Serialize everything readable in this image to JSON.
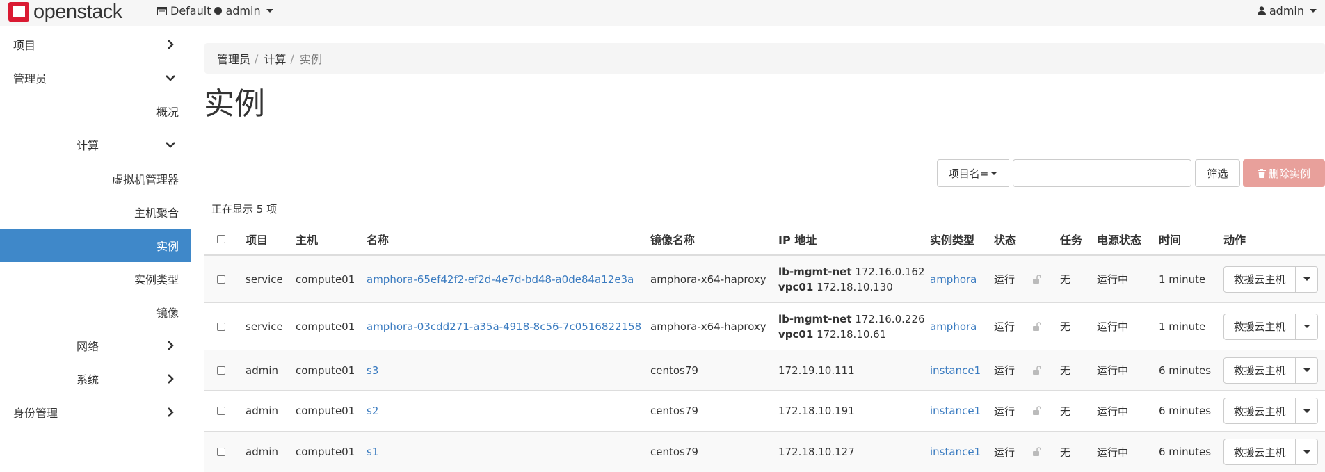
{
  "header": {
    "logo_text": "openstack",
    "domain": "Default",
    "project": "admin",
    "user": "admin"
  },
  "sidebar": {
    "items": [
      {
        "label": "项目",
        "chevron": "right"
      },
      {
        "label": "管理员",
        "chevron": "down"
      },
      {
        "label": "概况"
      },
      {
        "label": "计算",
        "chevron": "down"
      },
      {
        "label": "虚拟机管理器"
      },
      {
        "label": "主机聚合"
      },
      {
        "label": "实例",
        "active": true
      },
      {
        "label": "实例类型"
      },
      {
        "label": "镜像"
      },
      {
        "label": "网络",
        "chevron": "right"
      },
      {
        "label": "系统",
        "chevron": "right"
      },
      {
        "label": "身份管理",
        "chevron": "right"
      }
    ]
  },
  "breadcrumb": [
    "管理员",
    "计算",
    "实例"
  ],
  "page_title": "实例",
  "filter": {
    "field_label": "项目名=",
    "input_value": "",
    "filter_button": "筛选",
    "delete_button": "删除实例"
  },
  "count_text": "正在显示 5 项",
  "table": {
    "headers": [
      "项目",
      "主机",
      "名称",
      "镜像名称",
      "IP 地址",
      "实例类型",
      "状态",
      "任务",
      "电源状态",
      "时间",
      "动作"
    ],
    "rows": [
      {
        "project": "service",
        "host": "compute01",
        "name": "amphora-65ef42f2-ef2d-4e7d-bd48-a0de84a12e3a",
        "image": "amphora-x64-haproxy",
        "ip": [
          {
            "net": "lb-mgmt-net",
            "addr": "172.16.0.162"
          },
          {
            "net": "vpc01",
            "addr": "172.18.10.130"
          }
        ],
        "flavor": "amphora",
        "status": "运行",
        "task": "无",
        "power": "运行中",
        "time": "1 minute",
        "action": "救援云主机"
      },
      {
        "project": "service",
        "host": "compute01",
        "name": "amphora-03cdd271-a35a-4918-8c56-7c0516822158",
        "image": "amphora-x64-haproxy",
        "ip": [
          {
            "net": "lb-mgmt-net",
            "addr": "172.16.0.226"
          },
          {
            "net": "vpc01",
            "addr": "172.18.10.61"
          }
        ],
        "flavor": "amphora",
        "status": "运行",
        "task": "无",
        "power": "运行中",
        "time": "1 minute",
        "action": "救援云主机"
      },
      {
        "project": "admin",
        "host": "compute01",
        "name": "s3",
        "image": "centos79",
        "ip_plain": "172.19.10.111",
        "flavor": "instance1",
        "status": "运行",
        "task": "无",
        "power": "运行中",
        "time": "6 minutes",
        "action": "救援云主机"
      },
      {
        "project": "admin",
        "host": "compute01",
        "name": "s2",
        "image": "centos79",
        "ip_plain": "172.18.10.191",
        "flavor": "instance1",
        "status": "运行",
        "task": "无",
        "power": "运行中",
        "time": "6 minutes",
        "action": "救援云主机"
      },
      {
        "project": "admin",
        "host": "compute01",
        "name": "s1",
        "image": "centos79",
        "ip_plain": "172.18.10.127",
        "flavor": "instance1",
        "status": "运行",
        "task": "无",
        "power": "运行中",
        "time": "6 minutes",
        "action": "救援云主机"
      }
    ]
  },
  "colors": {
    "brand_red": "#da1a32",
    "active_blue": "#3f88c9",
    "link_blue": "#3a7bc0",
    "danger_light": "#e8a09b"
  },
  "icons": [
    "openstack-logo-icon",
    "project-selector-icon",
    "user-icon",
    "trash-icon",
    "lock-icon",
    "chevron-right-icon",
    "chevron-down-icon",
    "caret-down-icon"
  ]
}
